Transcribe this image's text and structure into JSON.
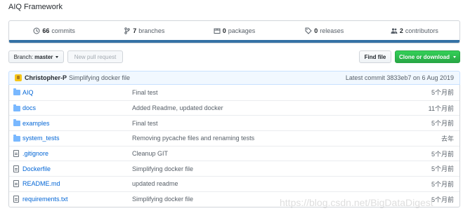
{
  "repo": {
    "title": "AIQ Framework"
  },
  "summary": {
    "stats": [
      {
        "icon": "history-icon",
        "count": "66",
        "label": "commits"
      },
      {
        "icon": "branch-icon",
        "count": "7",
        "label": "branches"
      },
      {
        "icon": "package-icon",
        "count": "0",
        "label": "packages"
      },
      {
        "icon": "tag-icon",
        "count": "0",
        "label": "releases"
      },
      {
        "icon": "people-icon",
        "count": "2",
        "label": "contributors"
      }
    ],
    "language_color": "#3572A5"
  },
  "toolbar": {
    "branch_prefix": "Branch:",
    "branch_name": "master",
    "new_pr_label": "New pull request",
    "find_file_label": "Find file",
    "clone_label": "Clone or download"
  },
  "commit": {
    "author": "Christopher-P",
    "message": "Simplifying docker file",
    "latest": "Latest commit 3833eb7 on 6 Aug 2019"
  },
  "files": [
    {
      "type": "dir",
      "name": "AIQ",
      "message": "Final test",
      "age": "5个月前"
    },
    {
      "type": "dir",
      "name": "docs",
      "message": "Added Readme, updated docker",
      "age": "11个月前"
    },
    {
      "type": "dir",
      "name": "examples",
      "message": "Final test",
      "age": "5个月前"
    },
    {
      "type": "dir",
      "name": "system_tests",
      "message": "Removing pycache files and renaming tests",
      "age": "去年"
    },
    {
      "type": "file",
      "name": ".gitignore",
      "message": "Cleanup GIT",
      "age": "5个月前"
    },
    {
      "type": "file",
      "name": "Dockerfile",
      "message": "Simplifying docker file",
      "age": "5个月前"
    },
    {
      "type": "file",
      "name": "README.md",
      "message": "updated readme",
      "age": "5个月前"
    },
    {
      "type": "file",
      "name": "requirements.txt",
      "message": "Simplifying docker file",
      "age": "5个月前"
    }
  ],
  "watermark": "https://blog.csdn.net/BigDataDigest",
  "colors": {
    "link": "#0366d6",
    "clone_green": "#28a745",
    "commit_bg": "#f1f8ff"
  }
}
